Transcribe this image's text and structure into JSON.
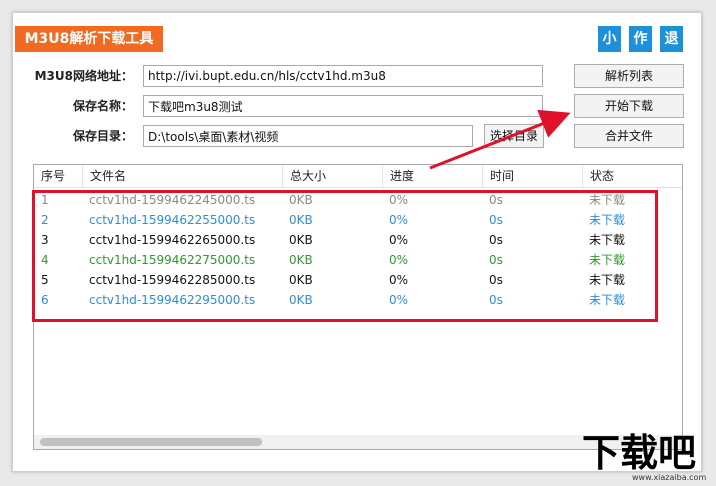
{
  "app": {
    "title": "M3U8解析下载工具"
  },
  "title_buttons": {
    "minimize": "小",
    "author": "作",
    "exit": "退"
  },
  "form": {
    "url_label": "M3U8网络地址：",
    "url_value": "http://ivi.bupt.edu.cn/hls/cctv1hd.m3u8",
    "name_label": "保存名称：",
    "name_value": "下载吧m3u8测试",
    "dir_label": "保存目录：",
    "dir_value": "D:\\tools\\桌面\\素材\\视频"
  },
  "buttons": {
    "parse_list": "解析列表",
    "start_download": "开始下载",
    "choose_dir": "选择目录",
    "merge_files": "合并文件"
  },
  "table": {
    "columns": [
      "序号",
      "文件名",
      "总大小",
      "进度",
      "时间",
      "状态"
    ],
    "rows": [
      {
        "num": "1",
        "file": "cctv1hd-1599462245000.ts",
        "size": "0KB",
        "progress": "0%",
        "time": "0s",
        "status": "未下载",
        "color": "#8a8a8a"
      },
      {
        "num": "2",
        "file": "cctv1hd-1599462255000.ts",
        "size": "0KB",
        "progress": "0%",
        "time": "0s",
        "status": "未下载",
        "color": "#2b8ed8"
      },
      {
        "num": "3",
        "file": "cctv1hd-1599462265000.ts",
        "size": "0KB",
        "progress": "0%",
        "time": "0s",
        "status": "未下载",
        "color": "#111111"
      },
      {
        "num": "4",
        "file": "cctv1hd-1599462275000.ts",
        "size": "0KB",
        "progress": "0%",
        "time": "0s",
        "status": "未下载",
        "color": "#2e9a2e"
      },
      {
        "num": "5",
        "file": "cctv1hd-1599462285000.ts",
        "size": "0KB",
        "progress": "0%",
        "time": "0s",
        "status": "未下载",
        "color": "#111111"
      },
      {
        "num": "6",
        "file": "cctv1hd-1599462295000.ts",
        "size": "0KB",
        "progress": "0%",
        "time": "0s",
        "status": "未下载",
        "color": "#2b8ed8"
      }
    ]
  },
  "colors": {
    "title_badge": "#f26a21",
    "title_buttons": "#1e90d9",
    "highlight": "#e0112b"
  },
  "watermark": {
    "text": "下载吧",
    "url": "www.xiazaiba.com"
  }
}
